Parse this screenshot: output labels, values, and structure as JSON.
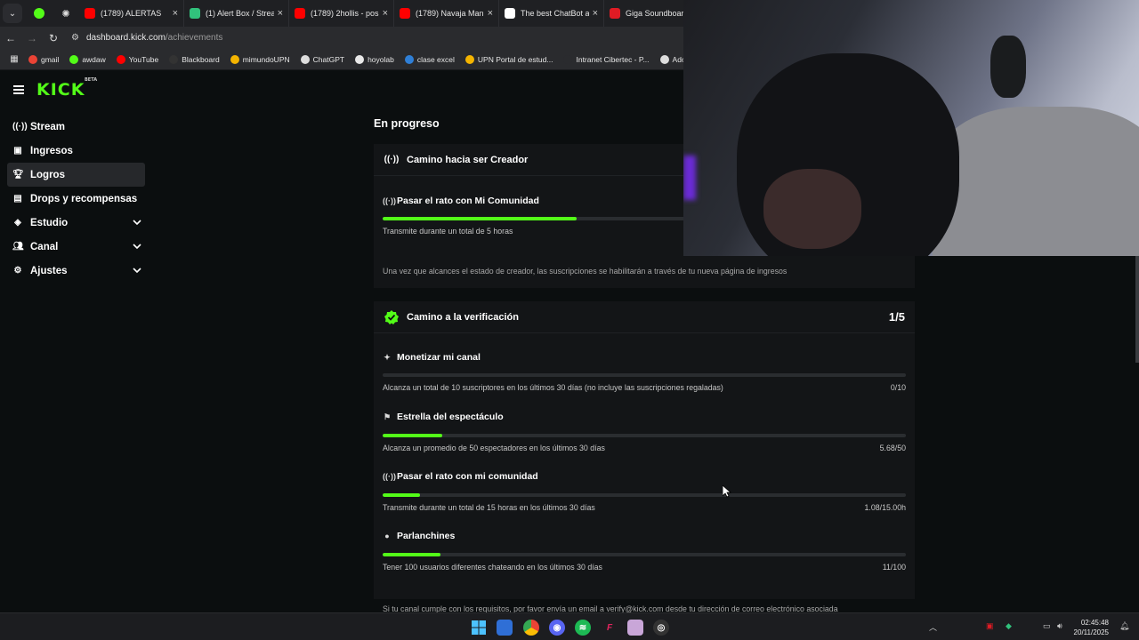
{
  "browser": {
    "tabs": [
      {
        "title": "(1789) ALERTAS",
        "color": "#ff0000"
      },
      {
        "title": "(1) Alert Box / Strea",
        "color": "#31c27c"
      },
      {
        "title": "(1789) 2hollis - pos",
        "color": "#ff0000"
      },
      {
        "title": "(1789) Navaja Man",
        "color": "#ff0000"
      },
      {
        "title": "The best ChatBot a",
        "color": "#ffffff"
      },
      {
        "title": "Giga Soundboard -",
        "color": "#e01b24"
      }
    ],
    "url_host": "dashboard.kick.com",
    "url_path": "/achievements",
    "bookmarks": [
      {
        "label": "gmail",
        "color": "#ea4335"
      },
      {
        "label": "awdaw",
        "color": "#53fc18"
      },
      {
        "label": "YouTube",
        "color": "#ff0000"
      },
      {
        "label": "Blackboard",
        "color": "#333333"
      },
      {
        "label": "mimundoUPN",
        "color": "#f4b400"
      },
      {
        "label": "ChatGPT",
        "color": "#dddddd"
      },
      {
        "label": "hoyolab",
        "color": "#e8e8e8"
      },
      {
        "label": "clase excel",
        "color": "#2f7fd6"
      },
      {
        "label": "UPN Portal de estud...",
        "color": "#f4b400"
      },
      {
        "label": "Intranet Cibertec - P...",
        "color": "#2a2b2e"
      },
      {
        "label": "Adobe Acrobat",
        "color": "#dddddd"
      }
    ]
  },
  "brand": {
    "logo": "KICK",
    "badge": "BETA",
    "accent": "#53fc18"
  },
  "sidebar": {
    "items": [
      {
        "label": "Stream",
        "icon": "broadcast-icon"
      },
      {
        "label": "Ingresos",
        "icon": "wallet-icon"
      },
      {
        "label": "Logros",
        "icon": "trophy-icon"
      },
      {
        "label": "Drops y recompensas",
        "icon": "gift-icon"
      },
      {
        "label": "Estudio",
        "icon": "layers-icon"
      },
      {
        "label": "Canal",
        "icon": "users-icon"
      },
      {
        "label": "Ajustes",
        "icon": "gear-icon"
      }
    ]
  },
  "main": {
    "section_title": "En progreso",
    "creator_card": {
      "title": "Camino hacia ser Creador",
      "task": {
        "title": "Pasar el rato con Mi Comunidad",
        "desc": "Transmite durante un total de 5 horas",
        "progress": 0.37
      },
      "note": "Una vez que alcances el estado de creador, las suscripciones se habilitarán a través de tu nueva página de ingresos"
    },
    "verify_card": {
      "title": "Camino a la verificación",
      "count": "1/5",
      "tasks": [
        {
          "title": "Monetizar mi canal",
          "desc": "Alcanza un total de 10 suscriptores en los últimos 30 días (no incluye las suscripciones regaladas)",
          "value": "0/10",
          "progress": 0.0
        },
        {
          "title": "Estrella del espectáculo",
          "desc": "Alcanza un promedio de 50 espectadores en los últimos 30 días",
          "value": "5.68/50",
          "progress": 0.114
        },
        {
          "title": "Pasar el rato con mi comunidad",
          "desc": "Transmite durante un total de 15 horas en los últimos 30 días",
          "value": "1.08/15.00h",
          "progress": 0.072
        },
        {
          "title": "Parlanchines",
          "desc": "Tener 100 usuarios diferentes chateando en los últimos 30 días",
          "value": "11/100",
          "progress": 0.11
        }
      ],
      "footer": "Si tu canal cumple con los requisitos, por favor envía un email a verify@kick.com desde tu dirección de correo electrónico asociada"
    }
  },
  "taskbar": {
    "time": "02:45:48",
    "date": "20/11/2025"
  }
}
